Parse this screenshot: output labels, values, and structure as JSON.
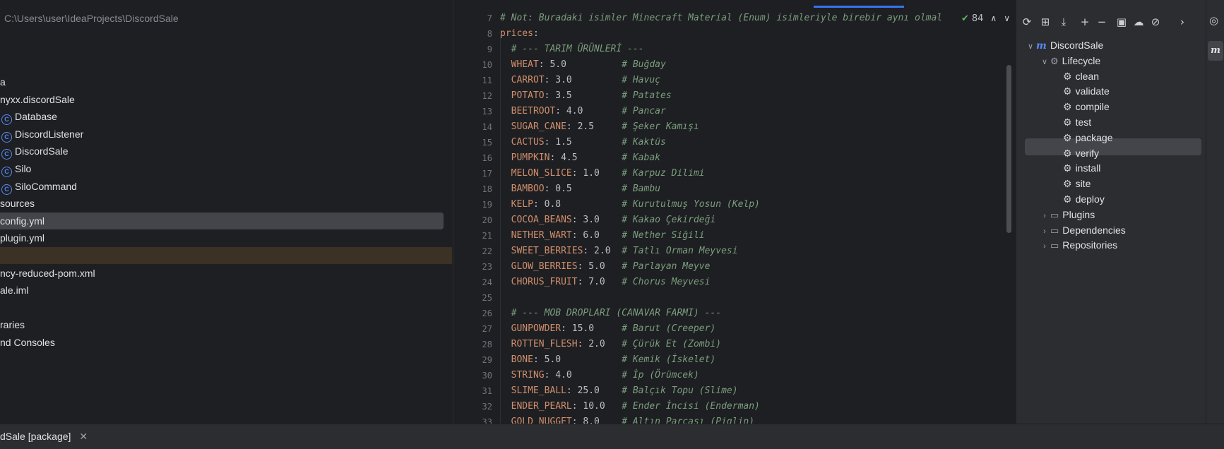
{
  "project": {
    "path": "C:\\Users\\user\\IdeaProjects\\DiscordSale",
    "rows": [
      {
        "label": "a",
        "icon": "",
        "kind": "folder"
      },
      {
        "label": "nyxx.discordSale",
        "icon": "",
        "kind": "package"
      },
      {
        "label": "Database",
        "icon": "class-icon",
        "kind": "class"
      },
      {
        "label": "DiscordListener",
        "icon": "class-icon",
        "kind": "class"
      },
      {
        "label": "DiscordSale",
        "icon": "class-icon",
        "kind": "class"
      },
      {
        "label": "Silo",
        "icon": "class-icon",
        "kind": "class"
      },
      {
        "label": "SiloCommand",
        "icon": "class-icon",
        "kind": "class"
      },
      {
        "label": "sources",
        "icon": "",
        "kind": "folder"
      },
      {
        "label": "config.yml",
        "icon": "",
        "kind": "file",
        "selected": true
      },
      {
        "label": "plugin.yml",
        "icon": "",
        "kind": "file"
      },
      {
        "label": "",
        "icon": "",
        "kind": "band"
      },
      {
        "label": "ncy-reduced-pom.xml",
        "icon": "",
        "kind": "file"
      },
      {
        "label": "ale.iml",
        "icon": "",
        "kind": "file"
      },
      {
        "label": "",
        "icon": "",
        "kind": "blank"
      },
      {
        "label": "raries",
        "icon": "",
        "kind": "folder"
      },
      {
        "label": "nd Consoles",
        "icon": "",
        "kind": "folder"
      }
    ]
  },
  "editor": {
    "inspection": {
      "count": "84",
      "icon": "check-icon"
    },
    "lines": [
      {
        "num": "7",
        "parts": [
          {
            "t": "# Not: Buradaki isimler Minecraft Material (Enum) isimleriyle birebir aynı olmal",
            "c": "cmt"
          }
        ]
      },
      {
        "num": "8",
        "parts": [
          {
            "t": "prices",
            "c": "top-key"
          },
          {
            "t": ":",
            "c": "val"
          }
        ]
      },
      {
        "num": "9",
        "parts": [
          {
            "t": "  # --- TARIM ÜRÜNLERİ ---",
            "c": "cmt"
          }
        ]
      },
      {
        "num": "10",
        "parts": [
          {
            "t": "  WHEAT",
            "c": "key"
          },
          {
            "t": ": 5.0          ",
            "c": "val"
          },
          {
            "t": "# Buğday",
            "c": "cmt"
          }
        ]
      },
      {
        "num": "11",
        "parts": [
          {
            "t": "  CARROT",
            "c": "key"
          },
          {
            "t": ": 3.0         ",
            "c": "val"
          },
          {
            "t": "# Havuç",
            "c": "cmt"
          }
        ]
      },
      {
        "num": "12",
        "parts": [
          {
            "t": "  POTATO",
            "c": "key"
          },
          {
            "t": ": 3.5         ",
            "c": "val"
          },
          {
            "t": "# Patates",
            "c": "cmt"
          }
        ]
      },
      {
        "num": "13",
        "parts": [
          {
            "t": "  BEETROOT",
            "c": "key"
          },
          {
            "t": ": 4.0       ",
            "c": "val"
          },
          {
            "t": "# Pancar",
            "c": "cmt"
          }
        ]
      },
      {
        "num": "14",
        "parts": [
          {
            "t": "  SUGAR_CANE",
            "c": "key"
          },
          {
            "t": ": 2.5     ",
            "c": "val"
          },
          {
            "t": "# Şeker Kamışı",
            "c": "cmt"
          }
        ]
      },
      {
        "num": "15",
        "parts": [
          {
            "t": "  CACTUS",
            "c": "key"
          },
          {
            "t": ": 1.5         ",
            "c": "val"
          },
          {
            "t": "# Kaktüs",
            "c": "cmt"
          }
        ]
      },
      {
        "num": "16",
        "parts": [
          {
            "t": "  PUMPKIN",
            "c": "key"
          },
          {
            "t": ": 4.5        ",
            "c": "val"
          },
          {
            "t": "# Kabak",
            "c": "cmt"
          }
        ]
      },
      {
        "num": "17",
        "parts": [
          {
            "t": "  MELON_SLICE",
            "c": "key"
          },
          {
            "t": ": 1.0    ",
            "c": "val"
          },
          {
            "t": "# Karpuz Dilimi",
            "c": "cmt"
          }
        ]
      },
      {
        "num": "18",
        "parts": [
          {
            "t": "  BAMBOO",
            "c": "key"
          },
          {
            "t": ": 0.5         ",
            "c": "val"
          },
          {
            "t": "# Bambu",
            "c": "cmt"
          }
        ]
      },
      {
        "num": "19",
        "parts": [
          {
            "t": "  KELP",
            "c": "key"
          },
          {
            "t": ": 0.8           ",
            "c": "val"
          },
          {
            "t": "# Kurutulmuş Yosun (Kelp)",
            "c": "cmt"
          }
        ]
      },
      {
        "num": "20",
        "parts": [
          {
            "t": "  COCOA_BEANS",
            "c": "key"
          },
          {
            "t": ": 3.0    ",
            "c": "val"
          },
          {
            "t": "# Kakao Çekirdeği",
            "c": "cmt"
          }
        ]
      },
      {
        "num": "21",
        "parts": [
          {
            "t": "  NETHER_WART",
            "c": "key"
          },
          {
            "t": ": 6.0    ",
            "c": "val"
          },
          {
            "t": "# Nether Siğili",
            "c": "cmt"
          }
        ]
      },
      {
        "num": "22",
        "parts": [
          {
            "t": "  SWEET_BERRIES",
            "c": "key"
          },
          {
            "t": ": 2.0  ",
            "c": "val"
          },
          {
            "t": "# Tatlı Orman Meyvesi",
            "c": "cmt"
          }
        ]
      },
      {
        "num": "23",
        "parts": [
          {
            "t": "  GLOW_BERRIES",
            "c": "key"
          },
          {
            "t": ": 5.0   ",
            "c": "val"
          },
          {
            "t": "# Parlayan Meyve",
            "c": "cmt"
          }
        ]
      },
      {
        "num": "24",
        "parts": [
          {
            "t": "  CHORUS_FRUIT",
            "c": "key"
          },
          {
            "t": ": 7.0   ",
            "c": "val"
          },
          {
            "t": "# Chorus Meyvesi",
            "c": "cmt"
          }
        ]
      },
      {
        "num": "25",
        "parts": []
      },
      {
        "num": "26",
        "parts": [
          {
            "t": "  # --- MOB DROPLARI (CANAVAR FARMI) ---",
            "c": "cmt"
          }
        ]
      },
      {
        "num": "27",
        "parts": [
          {
            "t": "  GUNPOWDER",
            "c": "key"
          },
          {
            "t": ": 15.0     ",
            "c": "val"
          },
          {
            "t": "# Barut (Creeper)",
            "c": "cmt"
          }
        ]
      },
      {
        "num": "28",
        "parts": [
          {
            "t": "  ROTTEN_FLESH",
            "c": "key"
          },
          {
            "t": ": 2.0   ",
            "c": "val"
          },
          {
            "t": "# Çürük Et (Zombi)",
            "c": "cmt"
          }
        ]
      },
      {
        "num": "29",
        "parts": [
          {
            "t": "  BONE",
            "c": "key"
          },
          {
            "t": ": 5.0           ",
            "c": "val"
          },
          {
            "t": "# Kemik (İskelet)",
            "c": "cmt"
          }
        ]
      },
      {
        "num": "30",
        "parts": [
          {
            "t": "  STRING",
            "c": "key"
          },
          {
            "t": ": 4.0         ",
            "c": "val"
          },
          {
            "t": "# İp (Örümcek)",
            "c": "cmt"
          }
        ]
      },
      {
        "num": "31",
        "parts": [
          {
            "t": "  SLIME_BALL",
            "c": "key"
          },
          {
            "t": ": 25.0    ",
            "c": "val"
          },
          {
            "t": "# Balçık Topu (Slime)",
            "c": "cmt"
          }
        ]
      },
      {
        "num": "32",
        "parts": [
          {
            "t": "  ENDER_PEARL",
            "c": "key"
          },
          {
            "t": ": 10.0   ",
            "c": "val"
          },
          {
            "t": "# Ender İncisi (Enderman)",
            "c": "cmt"
          }
        ]
      },
      {
        "num": "33",
        "parts": [
          {
            "t": "  GOLD_NUGGET",
            "c": "key"
          },
          {
            "t": ": 8.0    ",
            "c": "val"
          },
          {
            "t": "# Altın Parçası (Piglin)",
            "c": "cmt"
          }
        ]
      }
    ]
  },
  "maven": {
    "toolbar": [
      "reload-icon",
      "add-folder-icon",
      "download-icon",
      "plus-icon",
      "minus-icon",
      "run-config-icon",
      "offline-icon",
      "skip-tests-icon",
      "more-icon"
    ],
    "root": "DiscordSale",
    "lifecycle": "Lifecycle",
    "goals": [
      "clean",
      "validate",
      "compile",
      "test",
      "package",
      "verify",
      "install",
      "site",
      "deploy"
    ],
    "selected_goal": "package",
    "groups": [
      "Plugins",
      "Dependencies",
      "Repositories"
    ]
  },
  "right_strip": {
    "badge": "m"
  },
  "bottom": {
    "tab_label": "dSale [package]",
    "close_icon": "close-icon"
  }
}
